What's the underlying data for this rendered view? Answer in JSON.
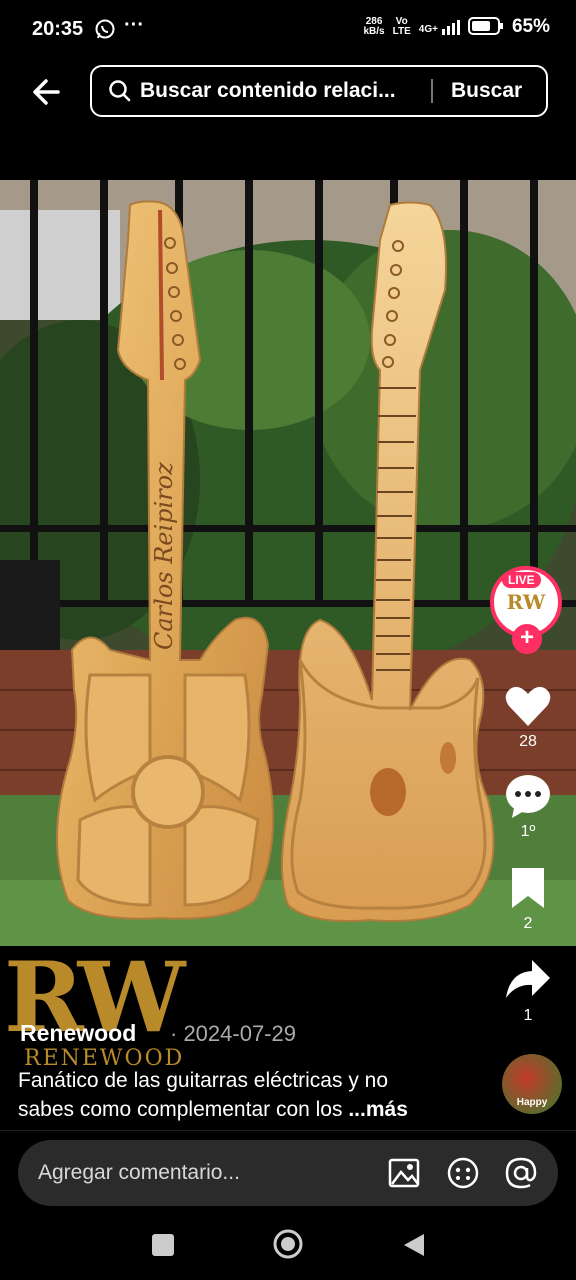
{
  "status": {
    "time": "20:35",
    "net_speed_top": "286",
    "net_speed_bottom": "kB/s",
    "volte_top": "Vo",
    "volte_bottom": "LTE",
    "signal": "4G+",
    "battery": "65%"
  },
  "search": {
    "query": "Buscar contenido relaci...",
    "button_label": "Buscar"
  },
  "media": {
    "engraving": "Carlos Reipiroz"
  },
  "rail": {
    "live_label": "LIVE",
    "likes": "28",
    "comments": "1º",
    "saves": "2",
    "shares": "1"
  },
  "post": {
    "author": "Renewood",
    "date": "· 2024-07-29",
    "logo_text": "RW",
    "logo_sub": "RENEWOOD",
    "caption_line1": "Fanático de las guitarras eléctricas y no",
    "caption_line2": "sabes como complementar con los",
    "more": "...más",
    "sound_label": "Happy"
  },
  "comment": {
    "placeholder": "Agregar comentario..."
  }
}
